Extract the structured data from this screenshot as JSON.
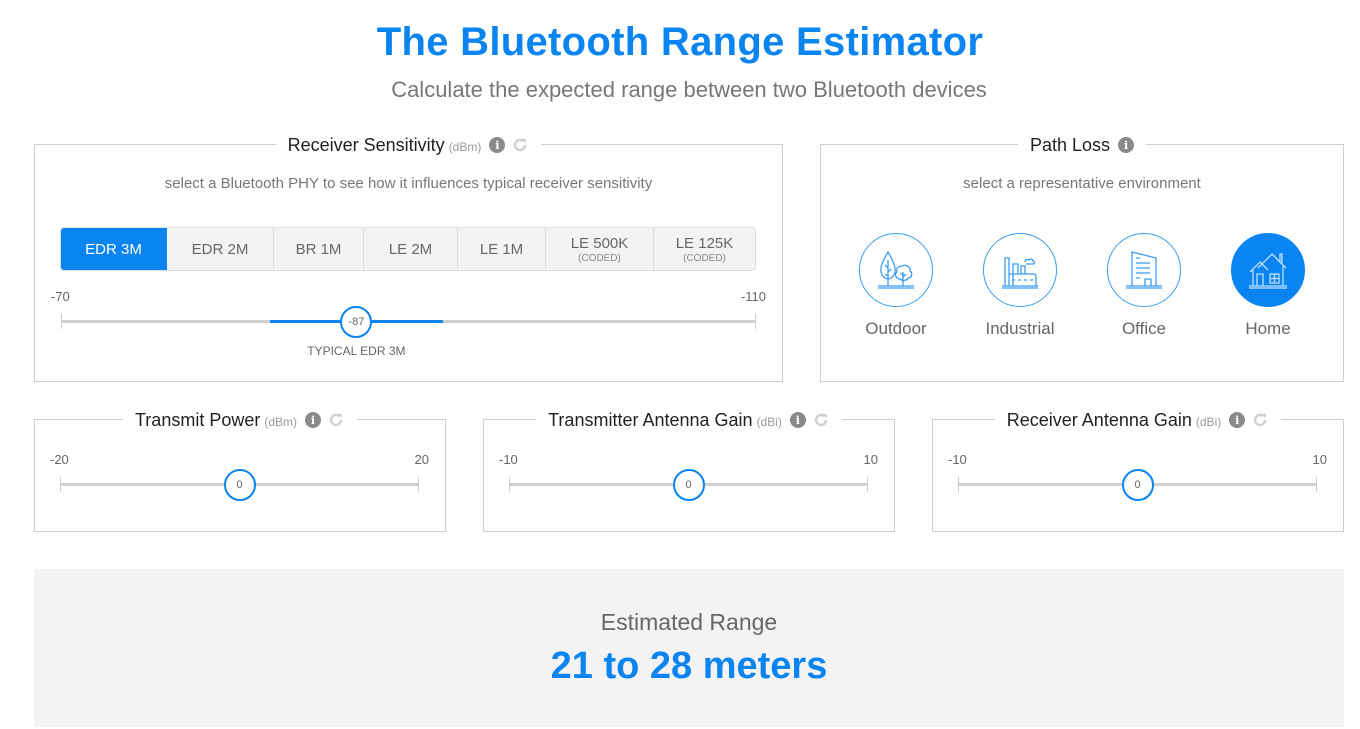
{
  "header": {
    "title": "The Bluetooth Range Estimator",
    "subtitle": "Calculate the expected range between two Bluetooth devices"
  },
  "receiver_sensitivity": {
    "title": "Receiver Sensitivity",
    "unit": "(dBm)",
    "helper": "select a Bluetooth PHY to see how it influences typical receiver sensitivity",
    "phy_tabs": [
      {
        "label": "EDR 3M",
        "sub": "",
        "active": true
      },
      {
        "label": "EDR 2M",
        "sub": "",
        "active": false
      },
      {
        "label": "BR 1M",
        "sub": "",
        "active": false
      },
      {
        "label": "LE 2M",
        "sub": "",
        "active": false
      },
      {
        "label": "LE 1M",
        "sub": "",
        "active": false
      },
      {
        "label": "LE 500K",
        "sub": "(CODED)",
        "active": false
      },
      {
        "label": "LE 125K",
        "sub": "(CODED)",
        "active": false
      }
    ],
    "slider": {
      "min_label": "-70",
      "max_label": "-110",
      "min": -70,
      "max": -110,
      "value": -87,
      "value_label": "-87",
      "typical_range": [
        -82,
        -92
      ],
      "caption": "TYPICAL EDR 3M"
    }
  },
  "path_loss": {
    "title": "Path Loss",
    "helper": "select a representative environment",
    "environments": [
      {
        "label": "Outdoor",
        "icon": "trees-icon",
        "active": false
      },
      {
        "label": "Industrial",
        "icon": "factory-icon",
        "active": false
      },
      {
        "label": "Office",
        "icon": "office-building-icon",
        "active": false
      },
      {
        "label": "Home",
        "icon": "house-icon",
        "active": true
      }
    ]
  },
  "transmit_power": {
    "title": "Transmit Power",
    "unit": "(dBm)",
    "min_label": "-20",
    "max_label": "20",
    "min": -20,
    "max": 20,
    "value": 0,
    "value_label": "0"
  },
  "tx_antenna_gain": {
    "title": "Transmitter Antenna Gain",
    "unit": "(dBi)",
    "min_label": "-10",
    "max_label": "10",
    "min": -10,
    "max": 10,
    "value": 0,
    "value_label": "0"
  },
  "rx_antenna_gain": {
    "title": "Receiver Antenna Gain",
    "unit": "(dBi)",
    "min_label": "-10",
    "max_label": "10",
    "min": -10,
    "max": 10,
    "value": 0,
    "value_label": "0"
  },
  "result": {
    "label": "Estimated Range",
    "value": "21 to 28 meters"
  },
  "colors": {
    "accent": "#0a84f0",
    "track": "#cfcfcf",
    "result_bg": "#f3f3f3"
  }
}
